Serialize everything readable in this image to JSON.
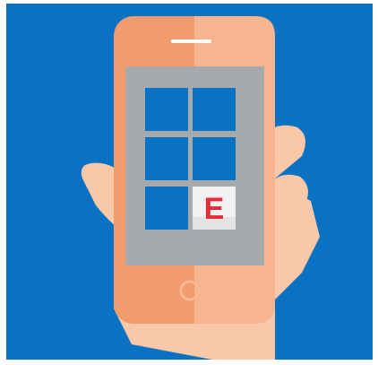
{
  "illustration": {
    "background_color": "#0a72c3",
    "hand_color": "#f8c8a8",
    "hand_shadow_color": "#e9a98a",
    "phone_body_color": "#f29b6d",
    "phone_highlight_color": "#f7b892",
    "screen_color": "#a7aaad",
    "tile_color": "#0a72c3",
    "app_icon": {
      "name": "e-app-icon",
      "letter": "E",
      "tile_color": "#f1f1f1",
      "letter_color": "#e32d38"
    }
  }
}
